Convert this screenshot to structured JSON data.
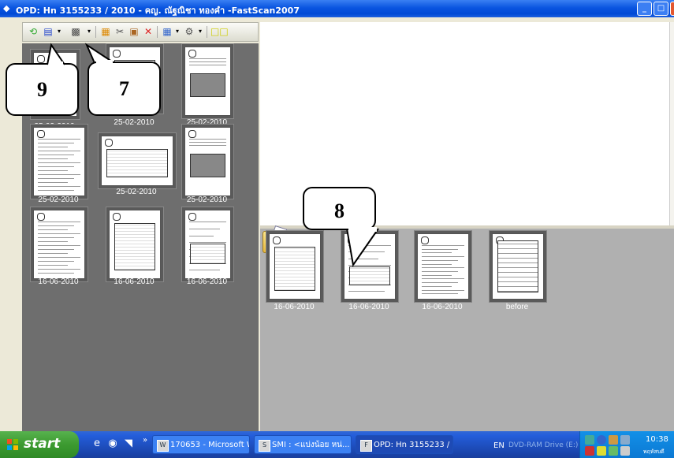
{
  "window": {
    "title": "OPD: Hn 3155233 / 2010 - คญ. ณัฐณิชา ทองคำ -FastScan2007",
    "controls": {
      "minimize": "_",
      "maximize": "□",
      "close": "✕"
    }
  },
  "toolbar": {
    "icons": [
      "refresh-icon",
      "save-icon",
      "dropdown-arrow",
      "scanner-icon",
      "dropdown-arrow",
      "properties-icon",
      "cut-icon",
      "paste-icon",
      "delete-icon",
      "grid-icon",
      "dropdown-arrow",
      "settings-icon",
      "dropdown-arrow",
      "two-pages-icon"
    ],
    "delete_glyph": "✕"
  },
  "left_thumbnails": [
    {
      "label": "25-02-2010",
      "kind": "doc"
    },
    {
      "label": "25-02-2010",
      "kind": "graph"
    },
    {
      "label": "25-02-2010",
      "kind": "scan"
    },
    {
      "label": "25-02-2010",
      "kind": "form"
    },
    {
      "label": "25-02-2010",
      "kind": "graph"
    },
    {
      "label": "25-02-2010",
      "kind": "scan"
    },
    {
      "label": "16-06-2010",
      "kind": "form"
    },
    {
      "label": "16-06-2010",
      "kind": "graph"
    },
    {
      "label": "16-06-2010",
      "kind": "doc"
    }
  ],
  "bottom_thumbnails": [
    {
      "label": "16-06-2010",
      "kind": "graph"
    },
    {
      "label": "16-06-2010",
      "kind": "doc"
    },
    {
      "label": "16-06-2010",
      "kind": "form"
    },
    {
      "label": "before",
      "kind": "table"
    }
  ],
  "callouts": {
    "nine": "9",
    "seven": "7",
    "eight": "8"
  },
  "taskbar": {
    "start_label": "start",
    "more_chevron": "»",
    "tasks": [
      {
        "label": "170653 - Microsoft W...",
        "active": false
      },
      {
        "label": "SMI : <แบ่งน้อย หน่...",
        "active": false
      },
      {
        "label": "OPD: Hn 3155233 / 2...",
        "active": true
      }
    ],
    "language": "EN",
    "drive_label": "DVD-RAM Drive (E:)",
    "clock": "10:38",
    "day_text": "พฤหัสบดี"
  },
  "colors": {
    "title_blue": "#0a55e0",
    "start_green": "#3c9a30",
    "tray_blue": "#0c79d3",
    "pane_gray": "#6e6e6e"
  }
}
